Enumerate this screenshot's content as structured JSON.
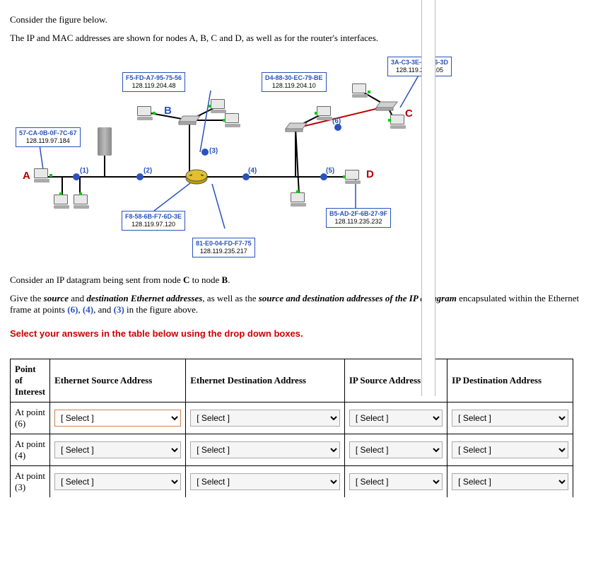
{
  "intro": {
    "line1": "Consider the figure below.",
    "line2": "The IP and MAC addresses are shown for nodes A, B, C and D, as well as for the router's interfaces."
  },
  "nodes": {
    "A": {
      "label": "A",
      "mac": "57-CA-0B-0F-7C-67",
      "ip": "128.119.97.184"
    },
    "B": {
      "label": "B",
      "mac": "F5-FD-A7-95-75-56",
      "ip": "128.119.204.48"
    },
    "C": {
      "label": "C",
      "mac": "3A-C3-3E-23-F6-3D",
      "ip": "128.119.235.105"
    },
    "D": {
      "label": "D",
      "mac": "B5-AD-2F-6B-27-9F",
      "ip": "128.119.235.232"
    }
  },
  "router_ifaces": {
    "left": {
      "mac": "F8-58-6B-F7-6D-3E",
      "ip": "128.119.97.120"
    },
    "top": {
      "mac": "D4-88-30-EC-79-BE",
      "ip": "128.119.204.10"
    },
    "right": {
      "mac": "81-E0-04-FD-F7-75",
      "ip": "128.119.235.217"
    }
  },
  "points": {
    "p1": "(1)",
    "p2": "(2)",
    "p3": "(3)",
    "p4": "(4)",
    "p5": "(5)",
    "p6": "(6)"
  },
  "q2": {
    "line1a": "Consider an IP datagram being sent from node ",
    "line1b": "C",
    "line1c": " to node ",
    "line1d": "B",
    "line1e": ".",
    "line2a": "Give the ",
    "line2b": "source",
    "line2c": " and ",
    "line2d": "destination Ethernet addresses",
    "line2e": ", as well as the ",
    "line2f": "source and destination addresses of the IP datagram",
    "line2g": " encapsulated within the Ethernet frame at points ",
    "n6": "(6)",
    "c1": ", ",
    "n4": "(4)",
    "c2": ", and ",
    "n3": "(3)",
    "line2h": " in the figure above."
  },
  "instruct": "Select your answers in the table below using the drop down boxes.",
  "table": {
    "headers": {
      "poi": "Point of Interest",
      "esrc": "Ethernet Source Address",
      "edst": "Ethernet Destination Address",
      "ipsrc": "IP Source Address",
      "ipdst": "IP Destination Address"
    },
    "rows": [
      {
        "poi": "At point (6)"
      },
      {
        "poi": "At point (4)"
      },
      {
        "poi": "At point (3)"
      }
    ],
    "select_placeholder": "[ Select ]"
  }
}
